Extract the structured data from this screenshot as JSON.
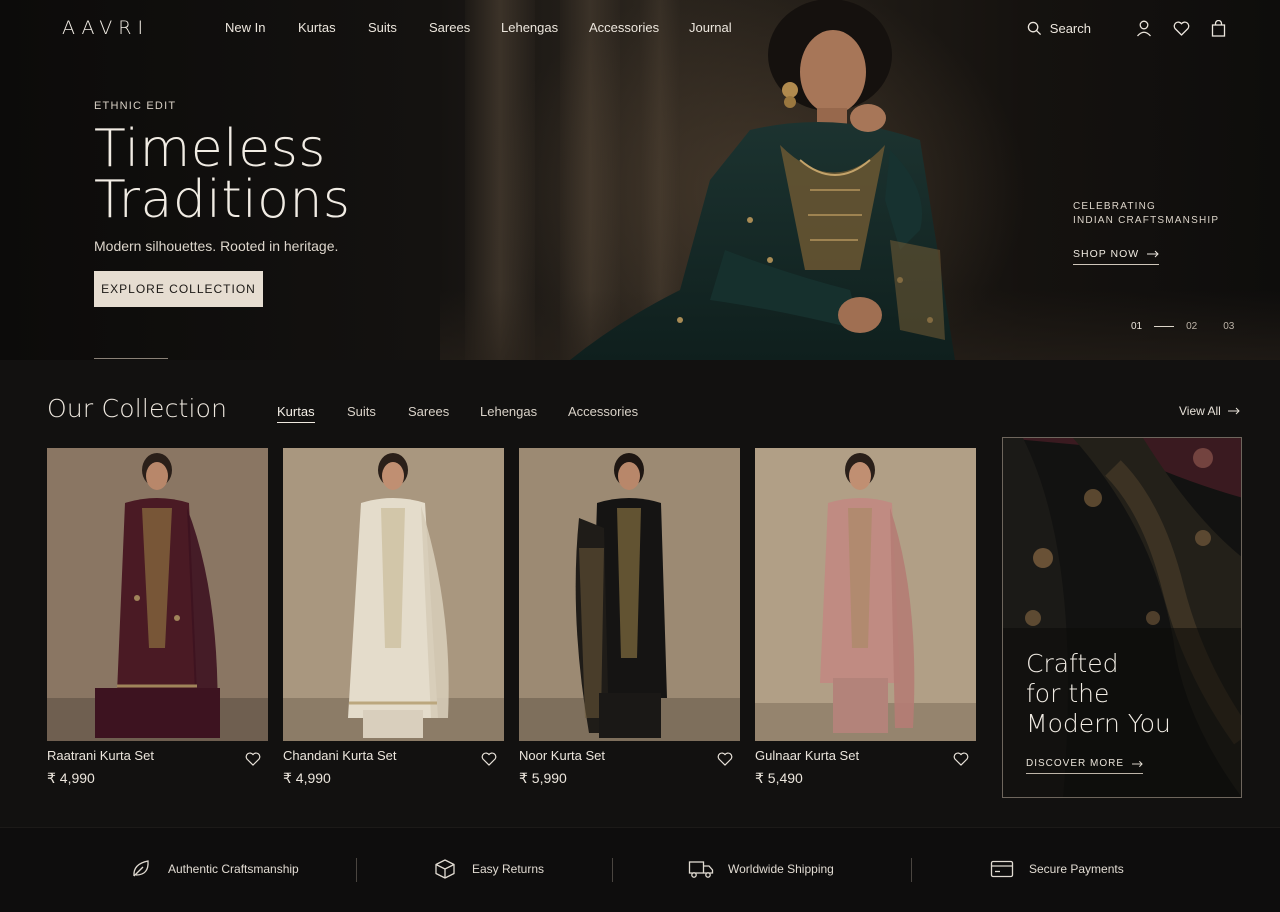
{
  "brand": {
    "logo": "AAVRI"
  },
  "nav": {
    "links": [
      "New In",
      "Kurtas",
      "Suits",
      "Sarees",
      "Lehengas",
      "Accessories",
      "Journal"
    ],
    "search_label": "Search",
    "icons": [
      "search-icon",
      "user-icon",
      "heart-icon",
      "bag-icon"
    ]
  },
  "hero": {
    "eyebrow": "ETHNIC EDIT",
    "title_line1": "Timeless",
    "title_line2": "Traditions",
    "subtitle": "Modern silhouettes. Rooted in heritage.",
    "cta": "EXPLORE COLLECTION",
    "side_line1": "CELEBRATING",
    "side_line2": "INDIAN CRAFTSMANSHIP",
    "side_cta": "SHOP NOW",
    "slides": [
      "01",
      "02",
      "03"
    ],
    "active_slide": "01"
  },
  "collection": {
    "title": "Our Collection",
    "tabs": [
      "Kurtas",
      "Suits",
      "Sarees",
      "Lehengas",
      "Accessories"
    ],
    "active_tab": "Kurtas",
    "view_all": "View All",
    "products": [
      {
        "name": "Raatrani Kurta Set",
        "price": "₹ 4,990",
        "color": "#4a1a24",
        "bg": "#8a7663"
      },
      {
        "name": "Chandani Kurta Set",
        "price": "₹ 4,990",
        "color": "#e4dccb",
        "bg": "#a9977f"
      },
      {
        "name": "Noor Kurta Set",
        "price": "₹ 5,990",
        "color": "#151413",
        "bg": "#9c8a73"
      },
      {
        "name": "Gulnaar Kurta Set",
        "price": "₹ 5,490",
        "color": "#c08b82",
        "bg": "#b19f86"
      }
    ]
  },
  "promo": {
    "title_line1": "Crafted",
    "title_line2": "for the",
    "title_line3": "Modern You",
    "cta": "DISCOVER MORE"
  },
  "features": [
    {
      "label": "Authentic Craftsmanship",
      "icon": "leaf-icon"
    },
    {
      "label": "Easy Returns",
      "icon": "box-icon"
    },
    {
      "label": "Worldwide Shipping",
      "icon": "truck-icon"
    },
    {
      "label": "Secure Payments",
      "icon": "card-icon"
    }
  ],
  "colors": {
    "background": "#121110",
    "cta_button": "#e6ddd1",
    "text": "#e9e3da"
  }
}
